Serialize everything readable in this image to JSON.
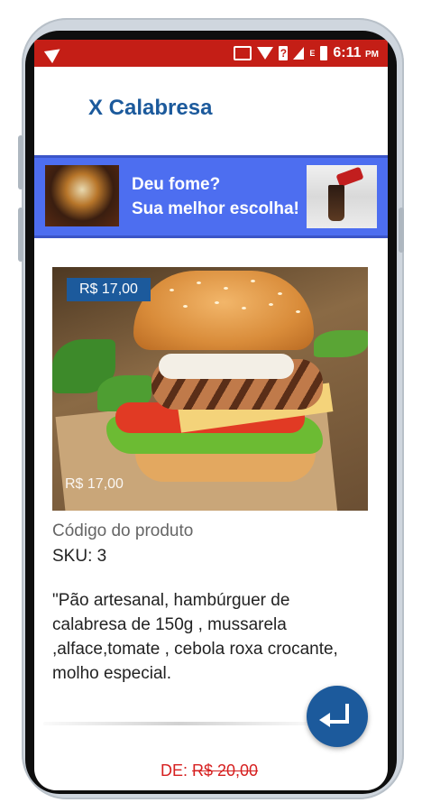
{
  "status_bar": {
    "time": "6:11",
    "ampm": "PM",
    "network": "E",
    "colors": {
      "bar": "#c41e16"
    }
  },
  "product": {
    "title": "X Calabresa",
    "price_badge": "R$ 17,00",
    "price_overlay": "R$ 17,00",
    "code_label": "Código do produto",
    "sku": "SKU: 3",
    "description": "\"Pão artesanal, hambúrguer de calabresa de 150g , mussarela ,alface,tomate , cebola roxa crocante, molho especial.",
    "old_price_prefix": "DE: ",
    "old_price": "R$ 20,00"
  },
  "banner": {
    "line1": "Deu fome?",
    "line2": "Sua melhor escolha!",
    "color": "#4d6ef0"
  },
  "fab": {
    "icon": "return-arrow-icon"
  },
  "colors": {
    "accent": "#1c5a9c",
    "price_old": "#d62020"
  }
}
